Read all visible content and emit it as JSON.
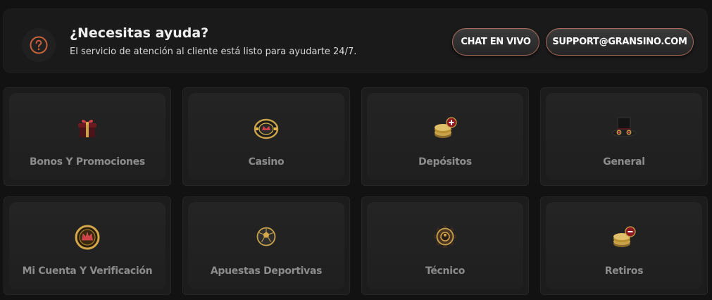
{
  "help": {
    "icon": "question-circle-icon",
    "title": "¿Necesitas ayuda?",
    "subtitle": "El servicio de atención al cliente está listo para ayudarte 24/7.",
    "chat_label": "CHAT EN VIVO",
    "support_label": "SUPPORT@GRANSINO.COM",
    "accent_color": "#c8613a",
    "button_border_color": "#a86a5a"
  },
  "categories": [
    {
      "label": "Bonos Y Promociones",
      "icon": "gift-box-icon"
    },
    {
      "label": "Casino",
      "icon": "casino-chip-icon"
    },
    {
      "label": "Depósitos",
      "icon": "coins-plus-icon"
    },
    {
      "label": "General",
      "icon": "top-hat-icon"
    },
    {
      "label": "Mi Cuenta Y Verificación",
      "icon": "crown-coin-icon"
    },
    {
      "label": "Apuestas Deportivas",
      "icon": "soccer-ball-icon"
    },
    {
      "label": "Técnico",
      "icon": "gear-icon"
    },
    {
      "label": "Retiros",
      "icon": "coins-minus-icon"
    }
  ]
}
